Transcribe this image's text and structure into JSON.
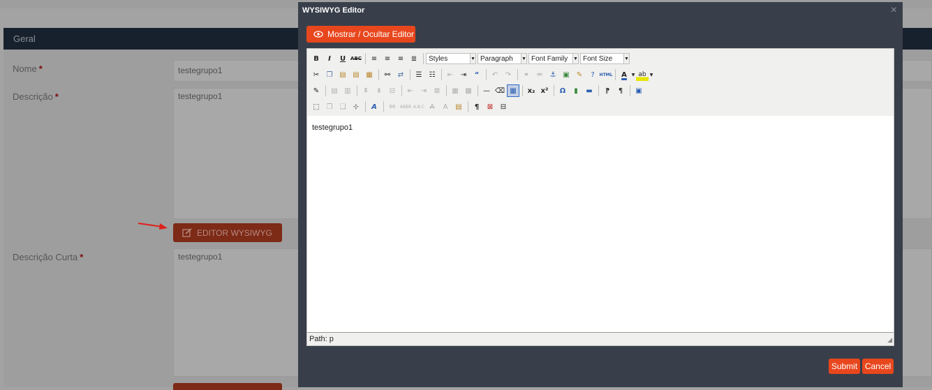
{
  "background": {
    "panel_title": "Geral",
    "fields": [
      {
        "label": "Nome",
        "value": "testegrupo1"
      },
      {
        "label": "Descrição",
        "value": "testegrupo1"
      },
      {
        "label": "Descrição Curta",
        "value": "testegrupo1"
      }
    ],
    "required_mark": "*",
    "editor_button_label": "EDITOR WYSIWYG"
  },
  "modal": {
    "title": "WYSIWYG Editor",
    "close_icon": "×",
    "toggle_label": "Mostrar / Ocultar Editor",
    "toolbar": {
      "row1": [
        "B",
        "I",
        "U",
        "ABC"
      ],
      "selects": [
        "Styles",
        "Paragraph",
        "Font Family",
        "Font Size"
      ]
    },
    "content_text": "testegrupo1",
    "path_text": "Path: p",
    "submit_label": "Submit",
    "cancel_label": "Cancel"
  },
  "colors": {
    "accent": "#e8471e",
    "modal_bg": "#383f4a",
    "header_bg": "#17212d"
  }
}
